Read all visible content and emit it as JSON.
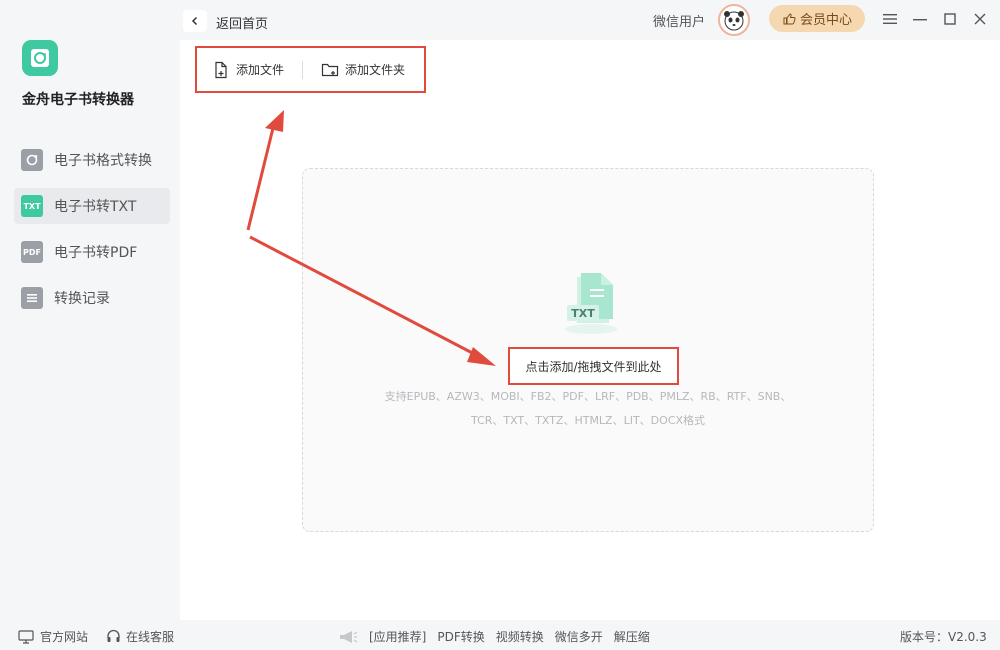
{
  "app": {
    "name": "金舟电子书转换器"
  },
  "sidebar": {
    "items": [
      {
        "label": "电子书格式转换",
        "icon": "refresh-book-icon"
      },
      {
        "label": "电子书转TXT",
        "icon": "txt-file-icon",
        "badge": "TXT"
      },
      {
        "label": "电子书转PDF",
        "icon": "pdf-file-icon",
        "badge": "PDF"
      },
      {
        "label": "转换记录",
        "icon": "history-list-icon"
      }
    ],
    "active_index": 1
  },
  "header": {
    "back_label": "返回首页",
    "username": "微信用户",
    "vip_label": "会员中心"
  },
  "toolbar": {
    "add_file": "添加文件",
    "add_folder": "添加文件夹"
  },
  "dropzone": {
    "illustration_text": "TXT",
    "hint": "点击添加/拖拽文件到此处",
    "formats_line1": "支持EPUB、AZW3、MOBI、FB2、PDF、LRF、PDB、PMLZ、RB、RTF、SNB、",
    "formats_line2": "TCR、TXT、TXTZ、HTMLZ、LIT、DOCX格式"
  },
  "footer": {
    "website": "官方网站",
    "support": "在线客服",
    "links": [
      "[应用推荐]",
      "PDF转换",
      "视频转换",
      "微信多开",
      "解压缩"
    ],
    "version": "版本号：V2.0.3"
  },
  "colors": {
    "accent": "#3ec9a0",
    "highlight": "#e04b3e",
    "vip": "#f6d8b0"
  }
}
